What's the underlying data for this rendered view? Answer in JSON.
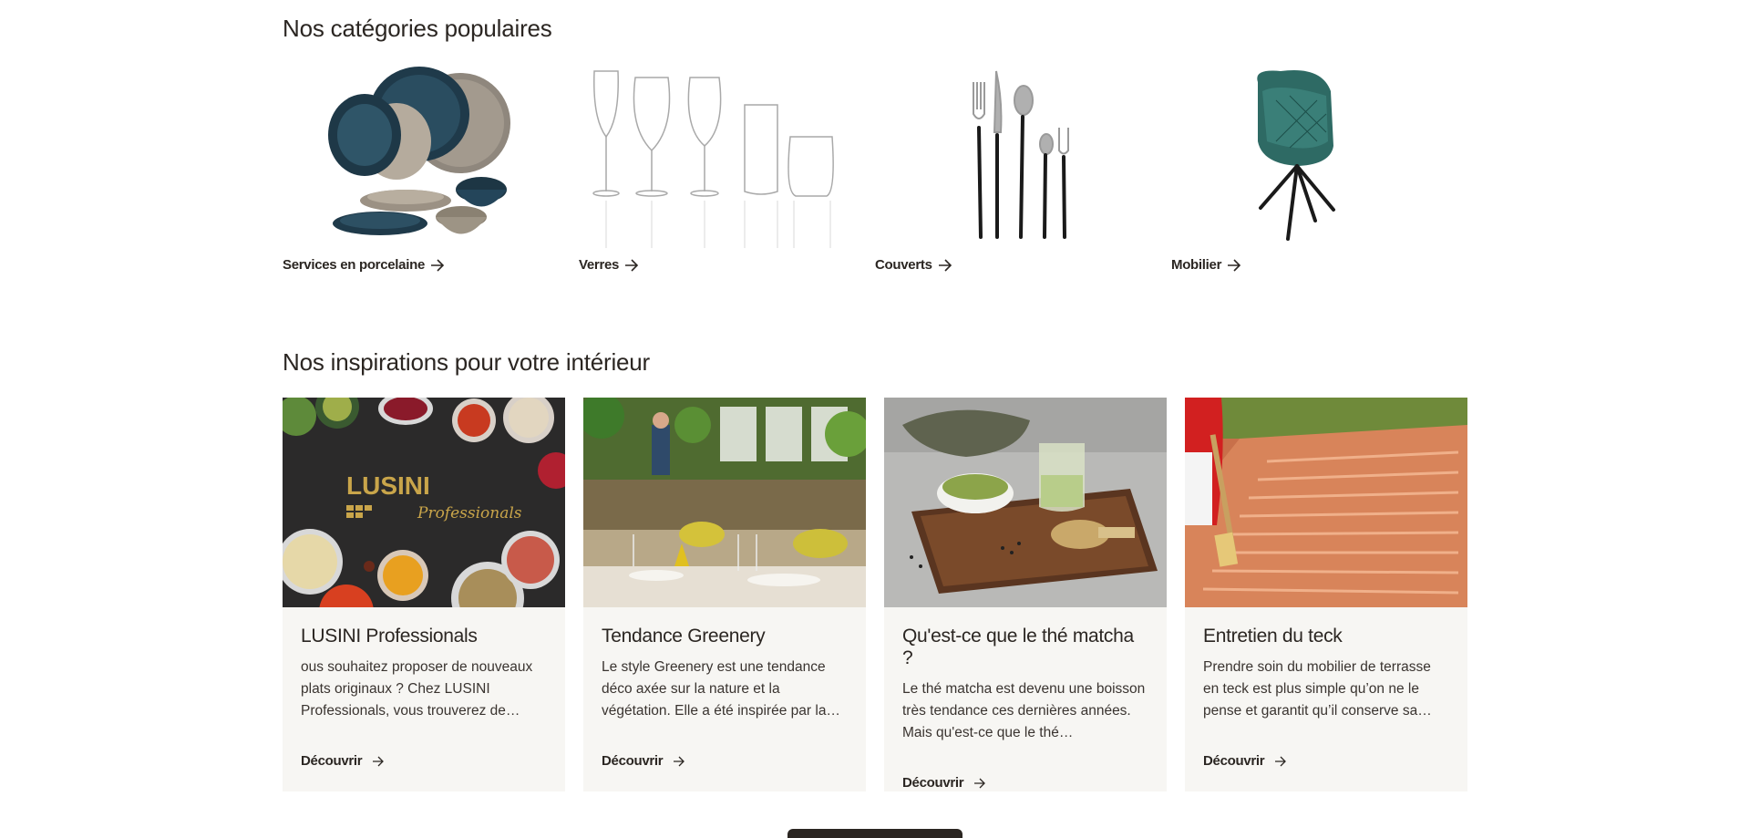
{
  "popular": {
    "title": "Nos catégories populaires",
    "items": [
      {
        "label": "Services en porcelaine",
        "icon": "porcelain-image"
      },
      {
        "label": "Verres",
        "icon": "glasses-image"
      },
      {
        "label": "Couverts",
        "icon": "cutlery-image"
      },
      {
        "label": "Mobilier",
        "icon": "chair-image"
      }
    ]
  },
  "inspirations": {
    "title": "Nos inspirations pour votre intérieur",
    "cards": [
      {
        "title": "LUSINI Professionals",
        "text": "ous souhaitez proposer de nouveaux plats originaux ? Chez LUSINI Professionals, vous trouverez de…",
        "link": "Découvrir",
        "logo_main": "LUSINI",
        "logo_sub": "Professionals"
      },
      {
        "title": "Tendance Greenery",
        "text": "Le style Greenery est une tendance déco axée sur la nature et la végétation. Elle a été inspirée par la…",
        "link": "Découvrir"
      },
      {
        "title": "Qu'est-ce que le thé matcha ?",
        "text": "Le thé matcha est devenu une boisson très tendance ces dernières années. Mais qu'est-ce que le thé…",
        "link": "Découvrir"
      },
      {
        "title": "Entretien du teck",
        "text": "Prendre soin du mobilier de terrasse en teck est plus simple qu’on ne le pense et garantit qu’il conserve sa…",
        "link": "Découvrir"
      }
    ]
  },
  "colors": {
    "text": "#2b2622",
    "card_bg": "#f7f6f3",
    "button": "#2b2622"
  }
}
